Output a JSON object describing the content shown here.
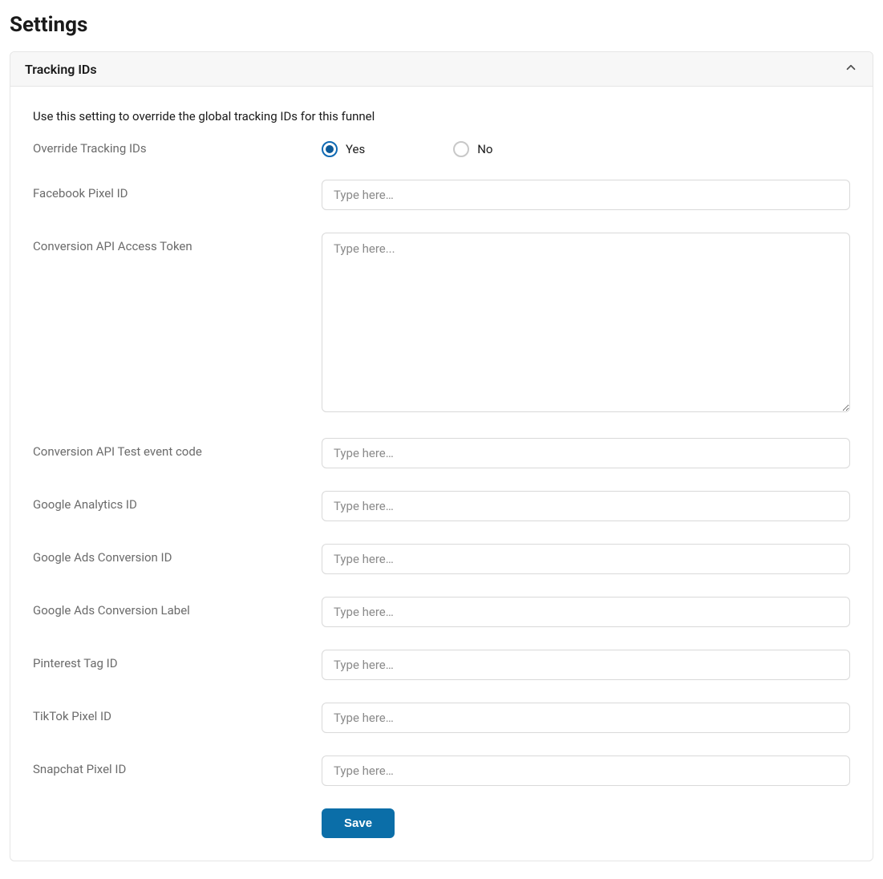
{
  "page": {
    "title": "Settings"
  },
  "panel": {
    "title": "Tracking IDs",
    "expanded": true,
    "description": "Use this setting to override the global tracking IDs for this funnel"
  },
  "fields": {
    "override": {
      "label": "Override Tracking IDs",
      "yes": "Yes",
      "no": "No",
      "value": "yes"
    },
    "facebookPixel": {
      "label": "Facebook Pixel ID",
      "placeholder": "Type here…",
      "value": ""
    },
    "conversionApiToken": {
      "label": "Conversion API Access Token",
      "placeholder": "Type here...",
      "value": ""
    },
    "conversionApiTestCode": {
      "label": "Conversion API Test event code",
      "placeholder": "Type here…",
      "value": ""
    },
    "googleAnalytics": {
      "label": "Google Analytics ID",
      "placeholder": "Type here…",
      "value": ""
    },
    "googleAdsConversionId": {
      "label": "Google Ads Conversion ID",
      "placeholder": "Type here…",
      "value": ""
    },
    "googleAdsConversionLabel": {
      "label": "Google Ads Conversion Label",
      "placeholder": "Type here…",
      "value": ""
    },
    "pinterestTag": {
      "label": "Pinterest Tag ID",
      "placeholder": "Type here…",
      "value": ""
    },
    "tiktokPixel": {
      "label": "TikTok Pixel ID",
      "placeholder": "Type here…",
      "value": ""
    },
    "snapchatPixel": {
      "label": "Snapchat Pixel ID",
      "placeholder": "Type here…",
      "value": ""
    }
  },
  "actions": {
    "save": "Save"
  }
}
